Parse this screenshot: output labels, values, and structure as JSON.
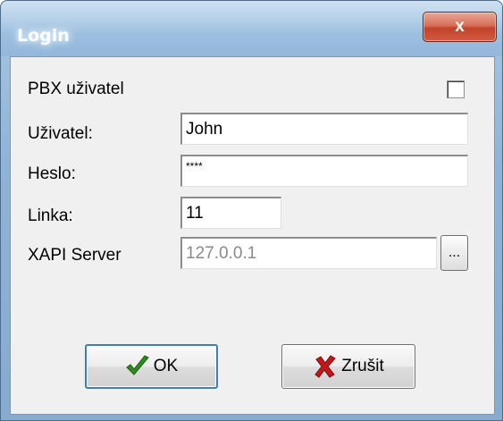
{
  "window": {
    "title": "Login",
    "close_symbol": "x"
  },
  "form": {
    "pbx_label": "PBX uživatel",
    "pbx_checked": false,
    "user_label": "Uživatel:",
    "user_value": "John",
    "password_label": "Heslo:",
    "password_value": "****",
    "line_label": "Linka:",
    "line_value": "11",
    "server_label": "XAPI Server",
    "server_value": "127.0.0.1",
    "browse_label": "..."
  },
  "buttons": {
    "ok_label": "OK",
    "cancel_label": "Zrušit"
  },
  "colors": {
    "ok_icon": "#2e8b1e",
    "cancel_icon": "#c0181a"
  },
  "icons": {
    "ok": "checkmark-icon",
    "cancel": "x-mark-icon",
    "close": "close-icon"
  }
}
